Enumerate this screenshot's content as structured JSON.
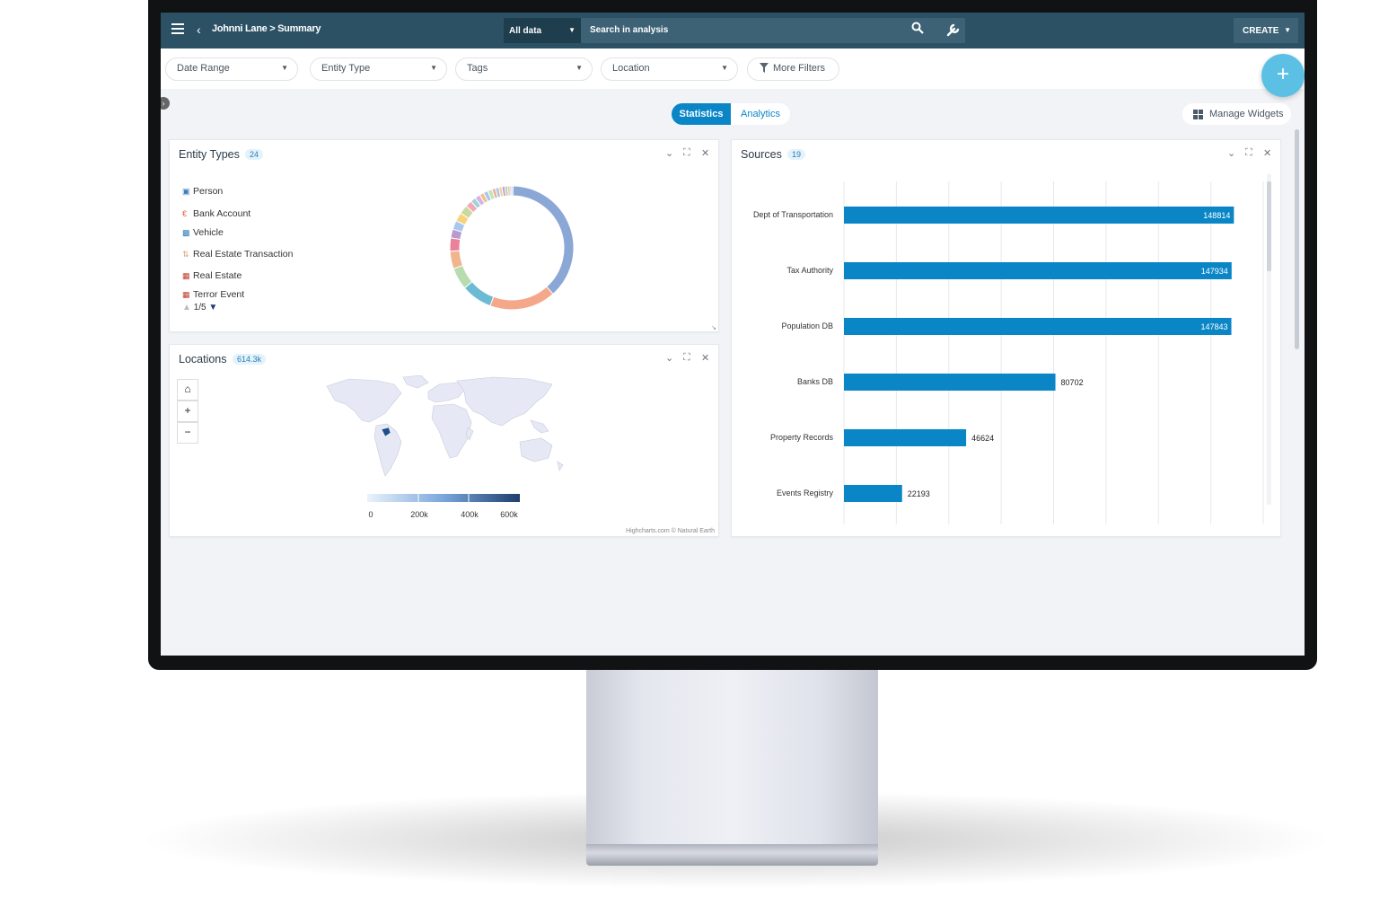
{
  "topbar": {
    "breadcrumb": "Johnni Lane > Summary",
    "scope": "All data",
    "search_placeholder": "Search in analysis",
    "create_label": "CREATE"
  },
  "filters": [
    {
      "label": "Date Range"
    },
    {
      "label": "Entity Type"
    },
    {
      "label": "Tags"
    },
    {
      "label": "Location"
    },
    {
      "label": "More Filters"
    }
  ],
  "view_toggle": {
    "statistics": "Statistics",
    "analytics": "Analytics"
  },
  "manage_widgets": "Manage Widgets",
  "entity_types": {
    "title": "Entity Types",
    "count": "24",
    "items": [
      {
        "label": "Person",
        "color": "#3d79b8",
        "icon": "person-icon"
      },
      {
        "label": "Bank Account",
        "color": "#e8553a",
        "icon": "euro-icon"
      },
      {
        "label": "Vehicle",
        "color": "#2a7fb8",
        "icon": "car-icon"
      },
      {
        "label": "Real Estate Transaction",
        "color": "#d8a070",
        "icon": "transaction-icon"
      },
      {
        "label": "Real Estate",
        "color": "#c0392b",
        "icon": "building-icon"
      },
      {
        "label": "Terror Event",
        "color": "#c0392b",
        "icon": "event-icon"
      }
    ],
    "pager": "1/5"
  },
  "locations": {
    "title": "Locations",
    "count": "614.3k",
    "colorbar_ticks": [
      "0",
      "200k",
      "400k",
      "600k"
    ],
    "credit": "Highcharts.com © Natural Earth"
  },
  "sources": {
    "title": "Sources",
    "count": "19"
  },
  "chart_data": [
    {
      "type": "bar",
      "orientation": "horizontal",
      "title": "Sources",
      "categories": [
        "Dept of Transportation",
        "Tax Authority",
        "Population DB",
        "Banks DB",
        "Property Records",
        "Events Registry"
      ],
      "values": [
        148814,
        147934,
        147843,
        80702,
        46624,
        22193
      ],
      "xlim": [
        0,
        160000
      ],
      "x_ticks": [
        "0",
        "20k",
        "40k",
        "60k",
        "80k",
        "100k",
        "120k",
        "140k",
        "160k"
      ],
      "bar_color": "#0a86c7",
      "grid": true
    },
    {
      "type": "pie",
      "title": "Entity Types",
      "donut": true,
      "series": [
        {
          "values": [
            33,
            15,
            7,
            5,
            4,
            3,
            2,
            2,
            2,
            2,
            1.5,
            1.2,
            1.2,
            1,
            1,
            1,
            0.8,
            0.8,
            0.7,
            0.7,
            0.6,
            0.5,
            0.4,
            0.3
          ]
        }
      ],
      "colors": [
        "#8aa7d6",
        "#f5a78a",
        "#6cbad3",
        "#b7dcb0",
        "#f0b58c",
        "#e9829a",
        "#b89ad1",
        "#a8c6f0",
        "#f8d27a",
        "#c9d9a0",
        "#f7a6b8",
        "#9fd5d8",
        "#d6b4e6",
        "#f3c08a",
        "#a6c8e8",
        "#c5e3b8",
        "#e8b0a0",
        "#b0c4de",
        "#f0d0a0",
        "#d0a0c0",
        "#a0d0c0",
        "#e0c080",
        "#c0c0e0",
        "#90b0d0"
      ]
    }
  ],
  "colors": {
    "topbar": "#2c5165",
    "accent": "#0a86c7",
    "fab": "#5bc0e4"
  }
}
